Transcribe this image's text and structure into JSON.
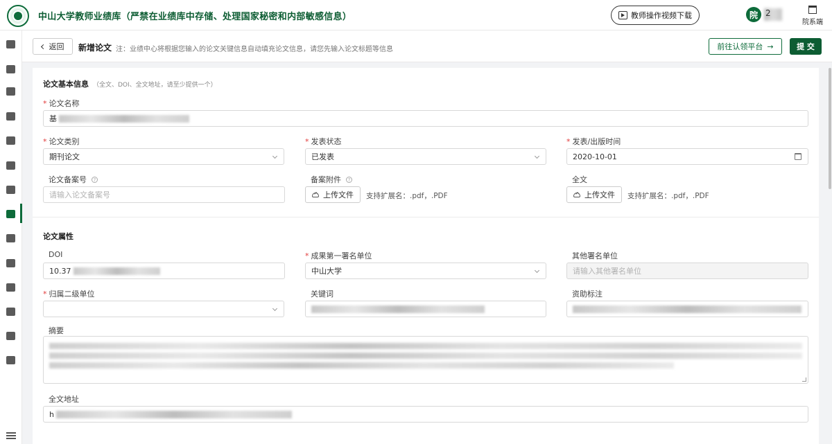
{
  "header": {
    "title": "中山大学教师业绩库（严禁在业绩库中存储、处理国家秘密和内部敏感信息）",
    "video_download_label": "教师操作视频下载",
    "avatar_char": "院",
    "user_name_visible": "2",
    "dept_switch_label": "院系端"
  },
  "sidebar": {
    "icons": [
      "home-icon",
      "building-icon",
      "user-icon",
      "book-icon",
      "document-icon",
      "medal-icon",
      "layers-icon",
      "paper-icon",
      "book-open-icon",
      "file-stack-icon",
      "patent-icon",
      "trophy-icon",
      "briefcase-icon",
      "bookmark-icon"
    ],
    "active_index": 6
  },
  "topbar": {
    "back_label": "返回",
    "page_title": "新增论文",
    "note": "注：业绩中心将根据您输入的论文关键信息自动填充论文信息，请您先输入论文标题等信息",
    "claim_platform_label": "前往认领平台",
    "submit_label": "提 交"
  },
  "basic": {
    "section_title": "论文基本信息",
    "section_hint": "（全文、DOI、全文地址，请至少提供一个）",
    "paper_name_label": "论文名称",
    "paper_name_value_prefix": "基",
    "category_label": "论文类别",
    "category_value": "期刊论文",
    "status_label": "发表状态",
    "status_value": "已发表",
    "pub_date_label": "发表/出版时间",
    "pub_date_value": "2020-10-01",
    "record_no_label": "论文备案号",
    "record_no_placeholder": "请输入论文备案号",
    "attachment_label": "备案附件",
    "upload_label": "上传文件",
    "ext_note": "支持扩展名：.pdf，.PDF",
    "fulltext_label": "全文"
  },
  "attributes": {
    "section_title": "论文属性",
    "doi_label": "DOI",
    "doi_value_prefix": "10.37",
    "first_unit_label": "成果第一署名单位",
    "first_unit_value": "中山大学",
    "other_units_label": "其他署名单位",
    "other_units_placeholder": "请输入其他署名单位",
    "secondary_unit_label": "归属二级单位",
    "keywords_label": "关键词",
    "funding_label": "资助标注",
    "abstract_label": "摘要",
    "fulltext_url_label": "全文地址",
    "fulltext_url_prefix": "h"
  },
  "colors": {
    "brand_green": "#0d5d33",
    "required_red": "#e23b3b"
  }
}
